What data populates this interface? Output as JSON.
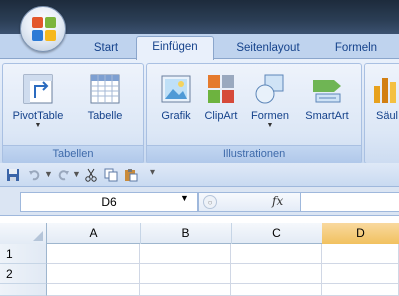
{
  "tabs": [
    {
      "label": "Start",
      "active": false
    },
    {
      "label": "Einfügen",
      "active": true
    },
    {
      "label": "Seitenlayout",
      "active": false
    },
    {
      "label": "Formeln",
      "active": false
    }
  ],
  "ribbon": {
    "groups": [
      {
        "label": "Tabellen",
        "buttons": [
          {
            "label": "PivotTable",
            "icon": "pivottable-icon"
          },
          {
            "label": "Tabelle",
            "icon": "table-icon"
          }
        ]
      },
      {
        "label": "Illustrationen",
        "buttons": [
          {
            "label": "Grafik",
            "icon": "picture-icon"
          },
          {
            "label": "ClipArt",
            "icon": "clipart-icon"
          },
          {
            "label": "Formen",
            "icon": "shapes-icon"
          },
          {
            "label": "SmartArt",
            "icon": "smartart-icon"
          }
        ]
      },
      {
        "label": "",
        "buttons": [
          {
            "label": "Säul",
            "icon": "column-chart-icon"
          }
        ]
      }
    ]
  },
  "quick_access": [
    "save-icon",
    "undo-icon",
    "redo-icon",
    "cut-icon",
    "copy-icon",
    "paste-icon",
    "customize-icon"
  ],
  "formula_bar": {
    "name_box": "D6",
    "fx": "fx",
    "formula": ""
  },
  "grid": {
    "columns": [
      {
        "label": "A",
        "selected": false
      },
      {
        "label": "B",
        "selected": false
      },
      {
        "label": "C",
        "selected": false
      },
      {
        "label": "D",
        "selected": true
      }
    ],
    "rows": [
      "1",
      "2"
    ]
  },
  "colors": {
    "accent": "#15428b",
    "selected_header": "#f1c15f",
    "ribbon_bg": "#dbe6f5"
  }
}
